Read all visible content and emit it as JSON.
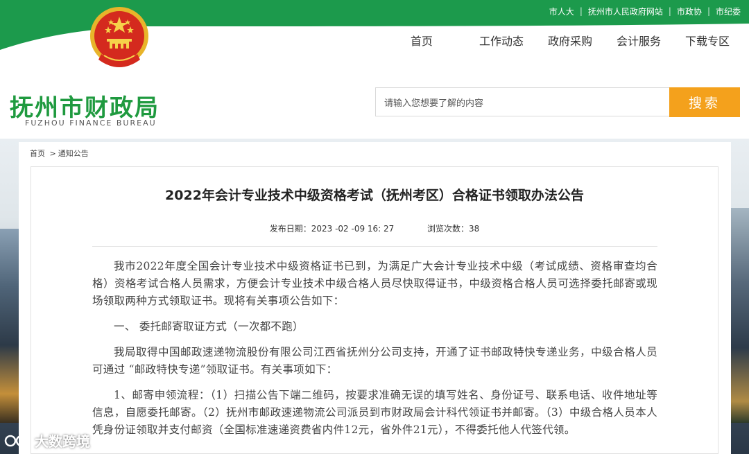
{
  "top_links": [
    "市人大",
    "抚州市人民政府网站",
    "市政协",
    "市纪委"
  ],
  "nav": [
    "首页",
    "工作动态",
    "政府采购",
    "会计服务",
    "下载专区"
  ],
  "logo": {
    "cn": "抚州市财政局",
    "en": "FUZHOU FINANCE BUREAU"
  },
  "search": {
    "placeholder": "请输入您想要了解的内容",
    "button": "搜索"
  },
  "breadcrumb": {
    "home": "首页",
    "sep": ">",
    "current": "通知公告"
  },
  "article": {
    "title": "2022年会计专业技术中级资格考试（抚州考区）合格证书领取办法公告",
    "publish_label": "发布日期：",
    "publish_date": "2023 -02 -09 16: 27",
    "views_label": "浏览次数：",
    "views": "38",
    "paragraphs": [
      "我市2022年度全国会计专业技术中级资格证书已到，为满足广大会计专业技术中级（考试成绩、资格审查均合格）资格考试合格人员需求，方便会计专业技术中级合格人员尽快取得证书，中级资格合格人员可选择委托邮寄或现场领取两种方式领取证书。现将有关事项公告如下：",
      "一、  委托邮寄取证方式（一次都不跑）",
      "我局取得中国邮政速递物流股份有限公司江西省抚州分公司支持，开通了证书邮政特快专递业务，中级合格人员可通过 “邮政特快专递”领取证书。有关事项如下：",
      "1、邮寄申领流程：（1）扫描公告下端二维码，按要求准确无误的填写姓名、身份证号、联系电话、收件地址等信息，自愿委托邮寄。（2）抚州市邮政速递物流公司派员到市财政局会计科代领证书并邮寄。（3）中级合格人员本人凭身份证领取并支付邮资（全国标准速递资费省内件12元，省外件21元），不得委托他人代签代领。"
    ]
  },
  "watermark": "大数跨境",
  "colors": {
    "green": "#1c9a4c",
    "logo_green": "#1f9a3f",
    "orange": "#f4a11c"
  }
}
